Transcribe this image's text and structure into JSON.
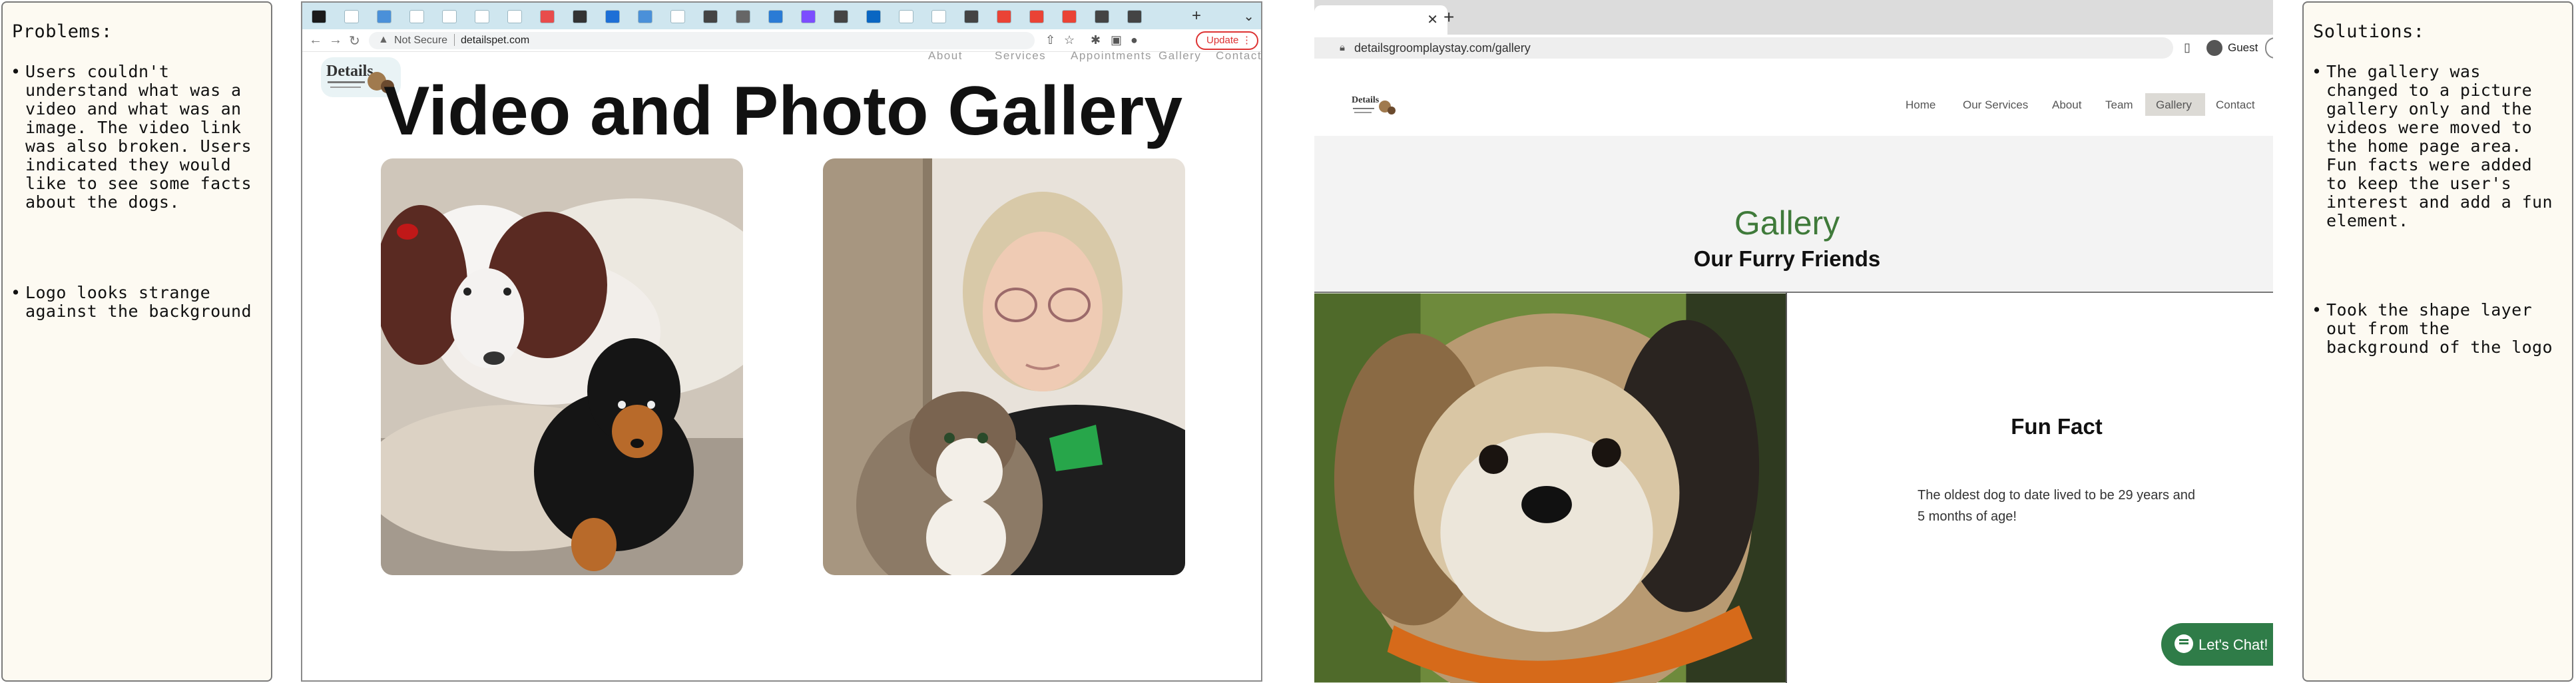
{
  "problems": {
    "heading": "Problems:",
    "items": [
      "Users couldn't understand what was a video and what was an image.  The video link was also broken.  Users indicated they would like to see some facts about the dogs.",
      "Logo looks strange against the background"
    ]
  },
  "solutions": {
    "heading": "Solutions:",
    "items": [
      "The gallery was changed to a picture gallery only and the videos were moved to the home page area.  Fun facts were added to keep the user's interest and add a fun element.",
      "Took the shape layer out from the background of the logo"
    ]
  },
  "old_site": {
    "security": "Not Secure",
    "url": "detailspet.com",
    "update_label": "Update",
    "logo_text": "Details",
    "nav": [
      "About",
      "Services",
      "Appointments",
      "Gallery",
      "Contact"
    ],
    "title": "Video and Photo Gallery"
  },
  "new_site": {
    "url": "detailsgroomplaystay.com/gallery",
    "profile_label": "Guest",
    "logo_text": "Details",
    "nav": [
      "Home",
      "Our Services",
      "About",
      "Team",
      "Gallery",
      "Contact"
    ],
    "active_nav": "Gallery",
    "gallery_title": "Gallery",
    "gallery_subtitle": "Our Furry Friends",
    "fun_fact_title": "Fun Fact",
    "fun_fact_text": "The oldest dog to date lived to be 29 years and 5 months of age!",
    "chat_label": "Let's Chat!"
  },
  "colors": {
    "accent_green": "#3f7a3a",
    "chat_green": "#2f7c48",
    "update_red": "#dd3333",
    "tab_strip_blue": "#cfe6ef"
  }
}
